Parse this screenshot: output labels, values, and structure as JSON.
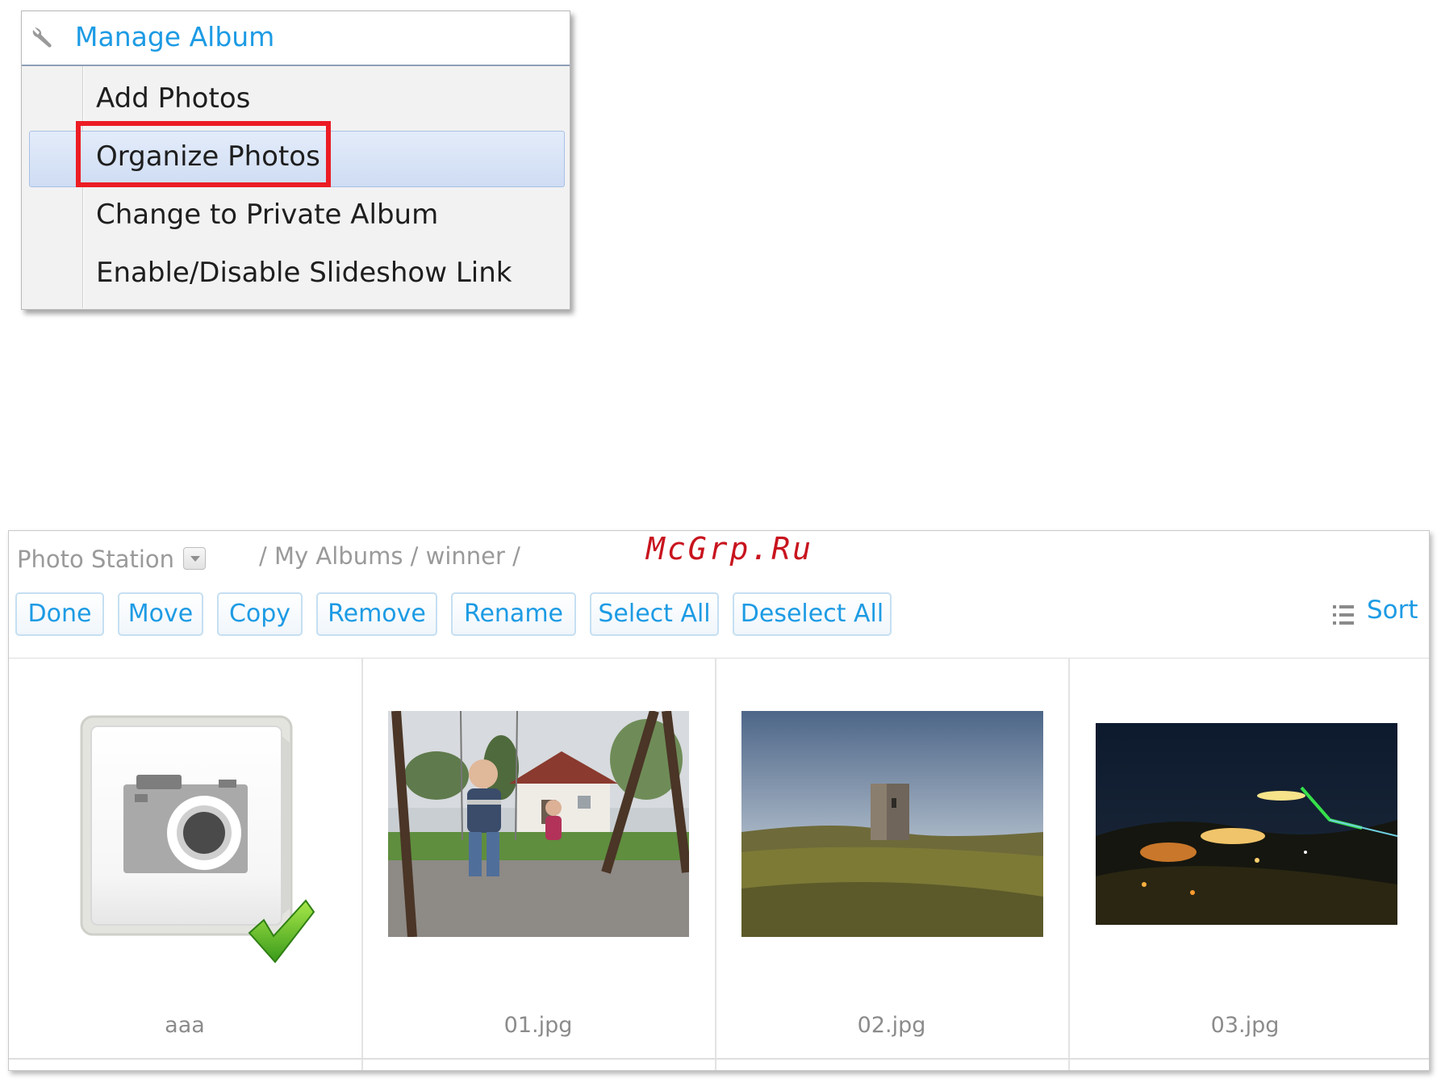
{
  "manage_menu": {
    "title": "Manage Album",
    "icon": "wrench-icon",
    "items": [
      {
        "label": "Add Photos"
      },
      {
        "label": "Organize Photos",
        "highlighted": true
      },
      {
        "label": "Change to Private Album"
      },
      {
        "label": "Enable/Disable Slideshow Link"
      }
    ]
  },
  "photo_station": {
    "title": "Photo Station",
    "breadcrumb": "/ My Albums / winner /",
    "watermark": "McGrp.Ru",
    "toolbar": {
      "done": "Done",
      "move": "Move",
      "copy": "Copy",
      "remove": "Remove",
      "rename": "Rename",
      "select_all": "Select All",
      "deselect_all": "Deselect All",
      "sort": "Sort"
    },
    "items": [
      {
        "caption": "aaa",
        "type": "album",
        "selected": true
      },
      {
        "caption": "01.jpg",
        "type": "photo"
      },
      {
        "caption": "02.jpg",
        "type": "photo"
      },
      {
        "caption": "03.jpg",
        "type": "photo"
      }
    ]
  },
  "colors": {
    "link_blue": "#1d9be4",
    "highlight_red": "#ec1c24",
    "menu_highlight": "#cfdcf3"
  }
}
